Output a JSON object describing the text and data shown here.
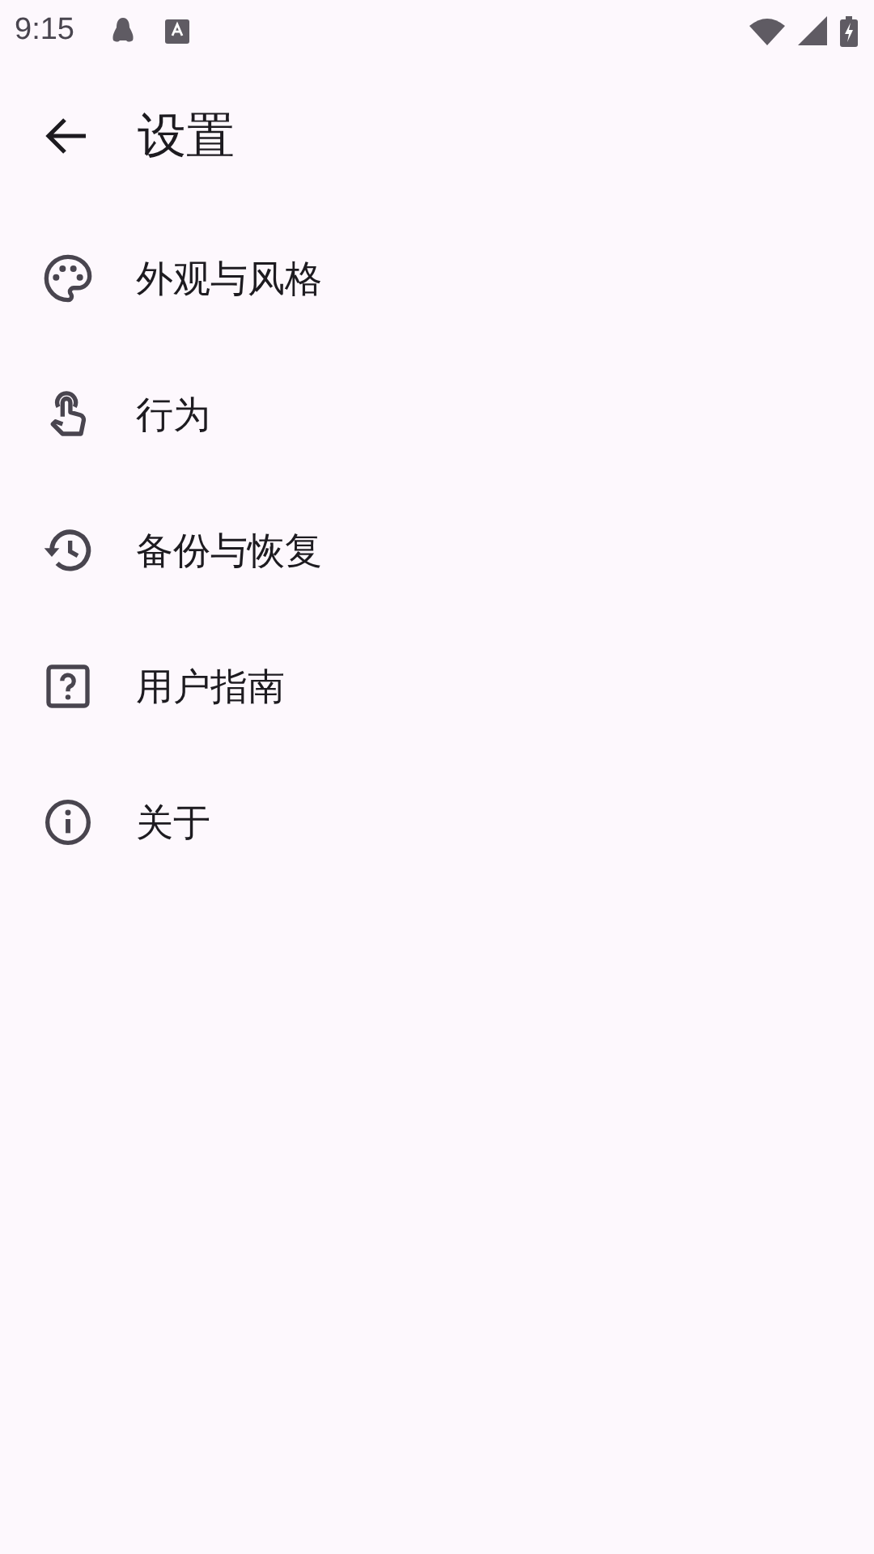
{
  "status_bar": {
    "time": "9:15"
  },
  "title": "设置",
  "items": [
    {
      "kind": "palette",
      "label": "外观与风格"
    },
    {
      "kind": "touch",
      "label": "行为"
    },
    {
      "kind": "history",
      "label": "备份与恢复"
    },
    {
      "kind": "help",
      "label": "用户指南"
    },
    {
      "kind": "info",
      "label": "关于"
    }
  ]
}
